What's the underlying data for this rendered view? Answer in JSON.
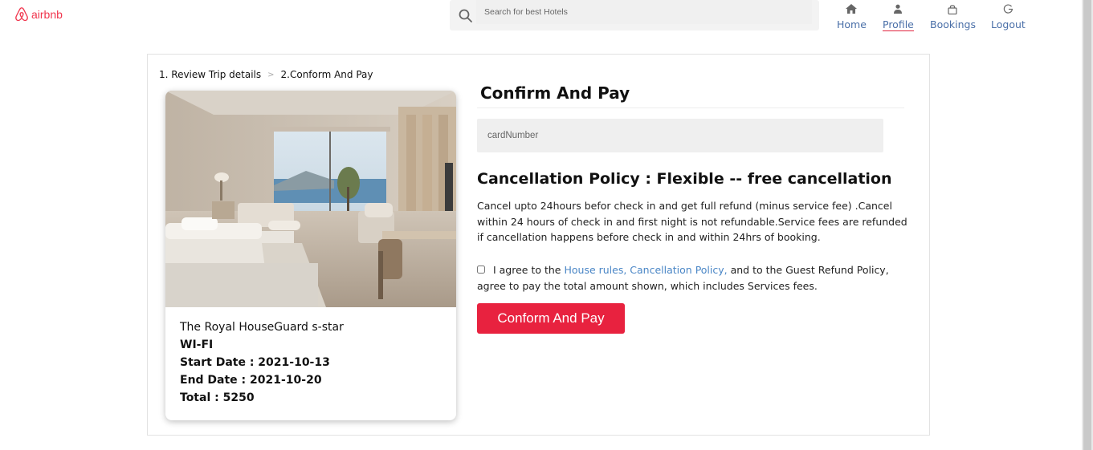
{
  "header": {
    "logo_text": "airbnb",
    "search_placeholder": "Search for best Hotels",
    "nav": [
      {
        "label": "Home",
        "icon": "home-icon"
      },
      {
        "label": "Profile",
        "icon": "user-icon",
        "active": true
      },
      {
        "label": "Bookings",
        "icon": "bag-icon"
      },
      {
        "label": "Logout",
        "icon": "logout-icon"
      }
    ]
  },
  "breadcrumb": {
    "step1": "1. Review Trip details",
    "separator": ">",
    "step2": "2.Conform And Pay"
  },
  "hotel": {
    "name": "The Royal HouseGuard s-star",
    "amenity": "WI-FI",
    "start_date": "Start Date : 2021-10-13",
    "end_date": "End Date : 2021-10-20",
    "total": "Total : 5250"
  },
  "payment": {
    "title": "Confirm And Pay",
    "card_placeholder": "cardNumber",
    "policy_title": "Cancellation Policy : Flexible -- free cancellation",
    "policy_text": "Cancel upto 24hours befor check in and get full refund (minus service fee) .Cancel within 24 hours of check in and first night is not refundable.Service fees are refunded if cancellation happens before check in and within 24hrs of booking.",
    "agree_prefix": "I agree to the ",
    "agree_link": "House rules, Cancellation Policy,",
    "agree_suffix": " and to the Guest Refund Policy, agree to pay the total amount shown, which includes Services fees.",
    "agree_checked": false,
    "button_label": "Conform And Pay"
  },
  "colors": {
    "brand": "#f0364e",
    "button": "#e8223f",
    "nav_link": "#4a6fa8",
    "policy_link": "#4a86c6"
  }
}
